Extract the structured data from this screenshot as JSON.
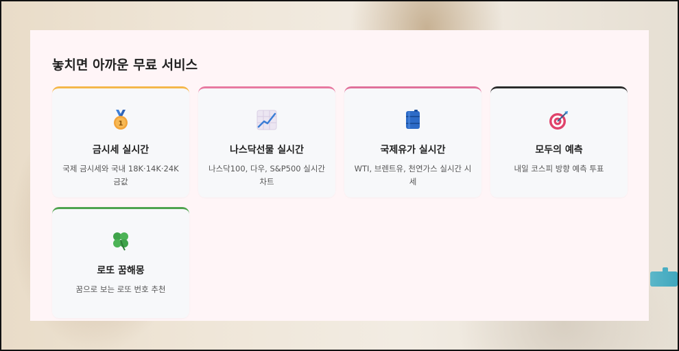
{
  "section": {
    "title": "놓치면 아까운 무료 서비스"
  },
  "cards": [
    {
      "name": "금시세 실시간",
      "desc": "국제 금시세와 국내 18K·14K·24K 금값",
      "accent": "#f5b74a",
      "icon": "gold-medal-icon"
    },
    {
      "name": "나스닥선물 실시간",
      "desc": "나스닥100, 다우, S&P500 실시간 차트",
      "accent": "#e879a0",
      "icon": "chart-increasing-icon"
    },
    {
      "name": "국제유가 실시간",
      "desc": "WTI, 브렌트유, 천연가스 실시간 시세",
      "accent": "#e0709a",
      "icon": "oil-drum-icon"
    },
    {
      "name": "모두의 예측",
      "desc": "내일 코스피 방향 예측 투표",
      "accent": "#2b2b2b",
      "icon": "direct-hit-target-icon"
    },
    {
      "name": "로또 꿈해몽",
      "desc": "꿈으로 보는 로또 번호 추천",
      "accent": "#4ea34e",
      "icon": "four-leaf-clover-icon"
    }
  ]
}
